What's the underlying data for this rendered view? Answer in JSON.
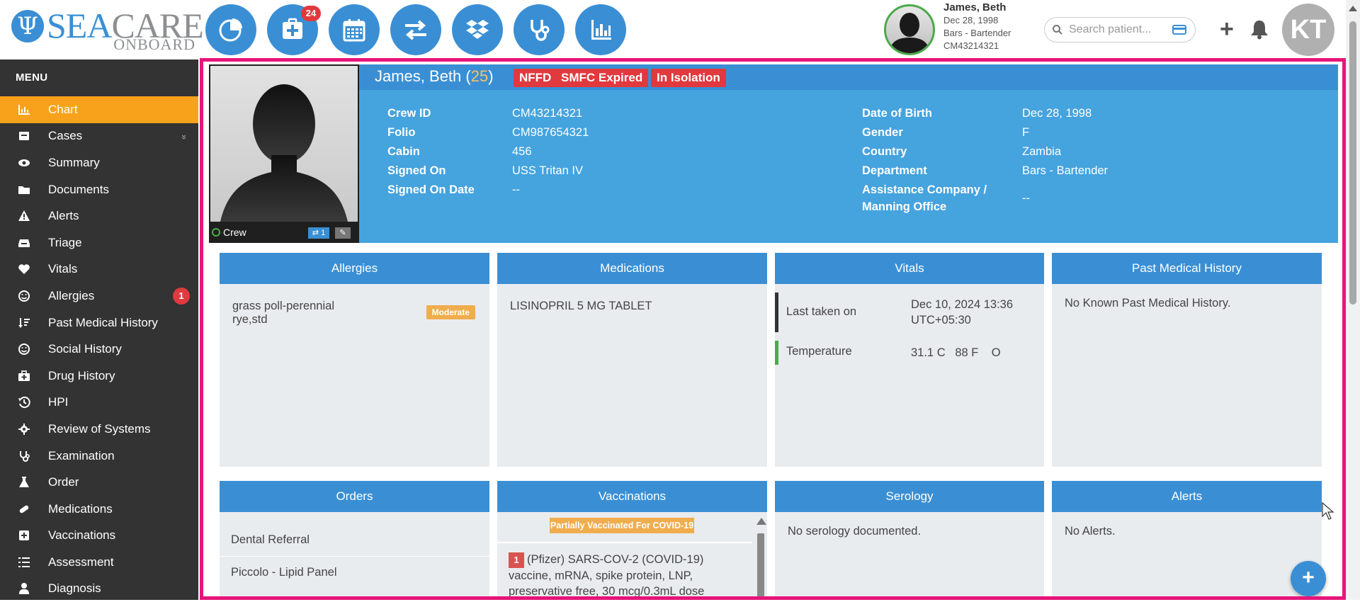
{
  "logo": {
    "part1": "SEA",
    "part2": "CARE",
    "sub": "ONBOARD"
  },
  "toolbar": {
    "icons": [
      "dashboard-pie-icon",
      "add-case-icon",
      "calendar-icon",
      "transfer-icon",
      "dropbox-icon",
      "stethoscope-icon",
      "reports-chart-icon"
    ],
    "add_case_badge": "24"
  },
  "patient_header": {
    "name": "James, Beth",
    "dob": "Dec 28, 1998",
    "department": "Bars - Bartender",
    "crew_id": "CM43214321"
  },
  "search": {
    "placeholder": "Search patient..."
  },
  "user": {
    "initials": "KT"
  },
  "menu": {
    "title": "MENU",
    "items": [
      {
        "label": "Chart",
        "icon": "chart-icon",
        "active": true
      },
      {
        "label": "Cases",
        "icon": "cases-icon",
        "expandable": true
      },
      {
        "label": "Summary",
        "icon": "eye-icon"
      },
      {
        "label": "Documents",
        "icon": "folder-icon"
      },
      {
        "label": "Alerts",
        "icon": "warning-icon"
      },
      {
        "label": "Triage",
        "icon": "inbox-icon"
      },
      {
        "label": "Vitals",
        "icon": "heart-icon"
      },
      {
        "label": "Allergies",
        "icon": "smile-icon",
        "badge": "1"
      },
      {
        "label": "Past Medical History",
        "icon": "sort-icon"
      },
      {
        "label": "Social History",
        "icon": "smile-icon"
      },
      {
        "label": "Drug History",
        "icon": "medkit-icon"
      },
      {
        "label": "HPI",
        "icon": "history-icon"
      },
      {
        "label": "Review of Systems",
        "icon": "gear-icon"
      },
      {
        "label": "Examination",
        "icon": "stethoscope-icon"
      },
      {
        "label": "Order",
        "icon": "flask-icon"
      },
      {
        "label": "Medications",
        "icon": "pill-icon"
      },
      {
        "label": "Vaccinations",
        "icon": "plus-square-icon"
      },
      {
        "label": "Assessment",
        "icon": "list-icon"
      },
      {
        "label": "Diagnosis",
        "icon": "user-md-icon"
      }
    ]
  },
  "profile": {
    "name": "James, Beth",
    "age": "25",
    "tags": [
      "NFFD",
      "SMFC Expired",
      "In Isolation"
    ],
    "photo_label": "Crew",
    "photo_badge": "1",
    "left": [
      {
        "label": "Crew ID",
        "value": "CM43214321"
      },
      {
        "label": "Folio",
        "value": "CM987654321"
      },
      {
        "label": "Cabin",
        "value": "456"
      },
      {
        "label": "Signed On",
        "value": "USS Tritan IV"
      },
      {
        "label": "Signed On Date",
        "value": "--"
      }
    ],
    "right": [
      {
        "label": "Date of Birth",
        "value": "Dec 28, 1998"
      },
      {
        "label": "Gender",
        "value": "F"
      },
      {
        "label": "Country",
        "value": "Zambia"
      },
      {
        "label": "Department",
        "value": "Bars - Bartender"
      },
      {
        "label": "Assistance Company /",
        "label2": "Manning Office",
        "value": "--"
      }
    ]
  },
  "cards": {
    "allergies": {
      "title": "Allergies",
      "item": "grass poll-perennial",
      "item2": "rye,std",
      "severity": "Moderate"
    },
    "medications": {
      "title": "Medications",
      "item": "LISINOPRIL 5 MG TABLET"
    },
    "vitals": {
      "title": "Vitals",
      "last_label": "Last taken on",
      "last_value": "Dec 10, 2024 13:36",
      "last_value2": "UTC+05:30",
      "temp_label": "Temperature",
      "temp_value": "31.1 C   88 F    O"
    },
    "pmh": {
      "title": "Past Medical History",
      "text": "No Known Past Medical History."
    },
    "orders": {
      "title": "Orders",
      "items": [
        "Dental Referral",
        "Piccolo - Lipid Panel"
      ]
    },
    "vaccinations": {
      "title": "Vaccinations",
      "status": "Partially Vaccinated For COVID-19",
      "num": "1",
      "text": "(Pfizer) SARS-COV-2 (COVID-19) vaccine, mRNA, spike protein, LNP,",
      "text2": "preservative free, 30 mcg/0.3mL dose"
    },
    "serology": {
      "title": "Serology",
      "text": "No serology documented."
    },
    "alerts": {
      "title": "Alerts",
      "text": "No Alerts."
    }
  },
  "colors": {
    "primary": "#3a8fd4",
    "active": "#f7a21a",
    "danger": "#e0393e",
    "warning": "#f0ad4e",
    "frame": "#e6157a",
    "sidebar": "#333333"
  }
}
